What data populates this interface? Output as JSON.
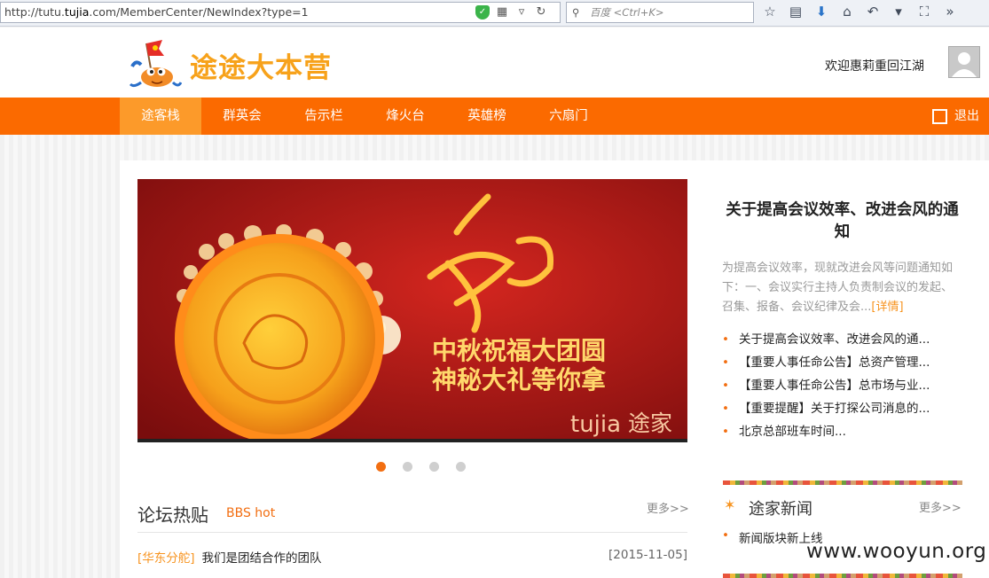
{
  "browser": {
    "url_prefix": "http://tutu.",
    "url_host": "tujia",
    "url_rest": ".com/MemberCenter/NewIndex?type=1",
    "search_placeholder": "百度 <Ctrl+K>"
  },
  "header": {
    "logo_text": "途途大本营",
    "welcome": "欢迎惠莉重回江湖"
  },
  "nav": {
    "items": [
      "途客栈",
      "群英会",
      "告示栏",
      "烽火台",
      "英雄榜",
      "六扇门"
    ],
    "active_index": 0,
    "logout": "退出"
  },
  "banner": {
    "calligraphy": "和",
    "line1": "中秋祝福大团圆",
    "line2": "神秘大礼等你拿",
    "brand_en": "tujia",
    "brand_cn": "途家",
    "dots": 4,
    "active_dot": 0
  },
  "bbs": {
    "title": "论坛热贴",
    "subtitle": "BBS hot",
    "more": "更多>>",
    "rows": [
      {
        "tag": "[华东分舵]",
        "text": "我们是团结合作的团队",
        "date": "[2015-11-05]"
      }
    ]
  },
  "notice": {
    "title": "关于提高会议效率、改进会风的通知",
    "summary": "为提高会议效率，现就改进会风等问题通知如下：一、会议实行主持人负责制会议的发起、召集、报备、会议纪律及会...",
    "detail_link": "[详情]",
    "items": [
      "关于提高会议效率、改进会风的通...",
      "【重要人事任命公告】总资产管理...",
      "【重要人事任命公告】总市场与业...",
      "【重要提醒】关于打探公司消息的...",
      "北京总部班车时间..."
    ]
  },
  "news": {
    "title": "途家新闻",
    "more": "更多>>",
    "items": [
      "新闻版块新上线"
    ]
  },
  "watermark": "www.wooyun.org",
  "colors": {
    "nav_orange": "#fb6a00",
    "nav_active": "#fc9a2a",
    "accent_orange": "#f7931e",
    "logo_yellow": "#f7a21b"
  }
}
